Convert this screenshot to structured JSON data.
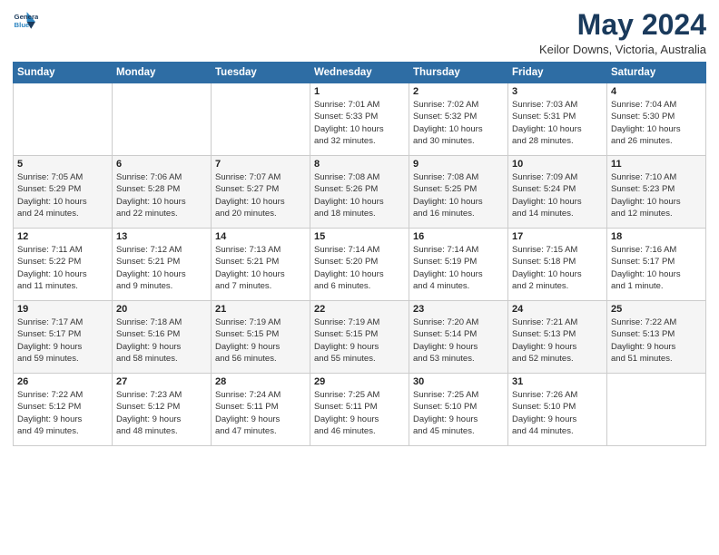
{
  "header": {
    "logo_line1": "General",
    "logo_line2": "Blue",
    "month": "May 2024",
    "location": "Keilor Downs, Victoria, Australia"
  },
  "days_of_week": [
    "Sunday",
    "Monday",
    "Tuesday",
    "Wednesday",
    "Thursday",
    "Friday",
    "Saturday"
  ],
  "weeks": [
    [
      {
        "day": "",
        "info": ""
      },
      {
        "day": "",
        "info": ""
      },
      {
        "day": "",
        "info": ""
      },
      {
        "day": "1",
        "info": "Sunrise: 7:01 AM\nSunset: 5:33 PM\nDaylight: 10 hours\nand 32 minutes."
      },
      {
        "day": "2",
        "info": "Sunrise: 7:02 AM\nSunset: 5:32 PM\nDaylight: 10 hours\nand 30 minutes."
      },
      {
        "day": "3",
        "info": "Sunrise: 7:03 AM\nSunset: 5:31 PM\nDaylight: 10 hours\nand 28 minutes."
      },
      {
        "day": "4",
        "info": "Sunrise: 7:04 AM\nSunset: 5:30 PM\nDaylight: 10 hours\nand 26 minutes."
      }
    ],
    [
      {
        "day": "5",
        "info": "Sunrise: 7:05 AM\nSunset: 5:29 PM\nDaylight: 10 hours\nand 24 minutes."
      },
      {
        "day": "6",
        "info": "Sunrise: 7:06 AM\nSunset: 5:28 PM\nDaylight: 10 hours\nand 22 minutes."
      },
      {
        "day": "7",
        "info": "Sunrise: 7:07 AM\nSunset: 5:27 PM\nDaylight: 10 hours\nand 20 minutes."
      },
      {
        "day": "8",
        "info": "Sunrise: 7:08 AM\nSunset: 5:26 PM\nDaylight: 10 hours\nand 18 minutes."
      },
      {
        "day": "9",
        "info": "Sunrise: 7:08 AM\nSunset: 5:25 PM\nDaylight: 10 hours\nand 16 minutes."
      },
      {
        "day": "10",
        "info": "Sunrise: 7:09 AM\nSunset: 5:24 PM\nDaylight: 10 hours\nand 14 minutes."
      },
      {
        "day": "11",
        "info": "Sunrise: 7:10 AM\nSunset: 5:23 PM\nDaylight: 10 hours\nand 12 minutes."
      }
    ],
    [
      {
        "day": "12",
        "info": "Sunrise: 7:11 AM\nSunset: 5:22 PM\nDaylight: 10 hours\nand 11 minutes."
      },
      {
        "day": "13",
        "info": "Sunrise: 7:12 AM\nSunset: 5:21 PM\nDaylight: 10 hours\nand 9 minutes."
      },
      {
        "day": "14",
        "info": "Sunrise: 7:13 AM\nSunset: 5:21 PM\nDaylight: 10 hours\nand 7 minutes."
      },
      {
        "day": "15",
        "info": "Sunrise: 7:14 AM\nSunset: 5:20 PM\nDaylight: 10 hours\nand 6 minutes."
      },
      {
        "day": "16",
        "info": "Sunrise: 7:14 AM\nSunset: 5:19 PM\nDaylight: 10 hours\nand 4 minutes."
      },
      {
        "day": "17",
        "info": "Sunrise: 7:15 AM\nSunset: 5:18 PM\nDaylight: 10 hours\nand 2 minutes."
      },
      {
        "day": "18",
        "info": "Sunrise: 7:16 AM\nSunset: 5:17 PM\nDaylight: 10 hours\nand 1 minute."
      }
    ],
    [
      {
        "day": "19",
        "info": "Sunrise: 7:17 AM\nSunset: 5:17 PM\nDaylight: 9 hours\nand 59 minutes."
      },
      {
        "day": "20",
        "info": "Sunrise: 7:18 AM\nSunset: 5:16 PM\nDaylight: 9 hours\nand 58 minutes."
      },
      {
        "day": "21",
        "info": "Sunrise: 7:19 AM\nSunset: 5:15 PM\nDaylight: 9 hours\nand 56 minutes."
      },
      {
        "day": "22",
        "info": "Sunrise: 7:19 AM\nSunset: 5:15 PM\nDaylight: 9 hours\nand 55 minutes."
      },
      {
        "day": "23",
        "info": "Sunrise: 7:20 AM\nSunset: 5:14 PM\nDaylight: 9 hours\nand 53 minutes."
      },
      {
        "day": "24",
        "info": "Sunrise: 7:21 AM\nSunset: 5:13 PM\nDaylight: 9 hours\nand 52 minutes."
      },
      {
        "day": "25",
        "info": "Sunrise: 7:22 AM\nSunset: 5:13 PM\nDaylight: 9 hours\nand 51 minutes."
      }
    ],
    [
      {
        "day": "26",
        "info": "Sunrise: 7:22 AM\nSunset: 5:12 PM\nDaylight: 9 hours\nand 49 minutes."
      },
      {
        "day": "27",
        "info": "Sunrise: 7:23 AM\nSunset: 5:12 PM\nDaylight: 9 hours\nand 48 minutes."
      },
      {
        "day": "28",
        "info": "Sunrise: 7:24 AM\nSunset: 5:11 PM\nDaylight: 9 hours\nand 47 minutes."
      },
      {
        "day": "29",
        "info": "Sunrise: 7:25 AM\nSunset: 5:11 PM\nDaylight: 9 hours\nand 46 minutes."
      },
      {
        "day": "30",
        "info": "Sunrise: 7:25 AM\nSunset: 5:10 PM\nDaylight: 9 hours\nand 45 minutes."
      },
      {
        "day": "31",
        "info": "Sunrise: 7:26 AM\nSunset: 5:10 PM\nDaylight: 9 hours\nand 44 minutes."
      },
      {
        "day": "",
        "info": ""
      }
    ]
  ]
}
